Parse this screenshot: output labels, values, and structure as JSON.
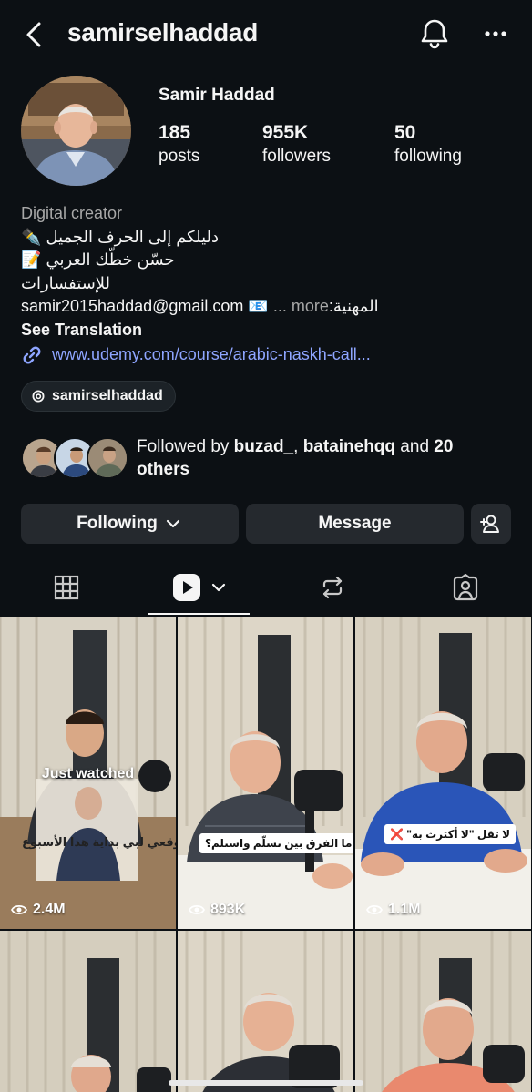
{
  "header": {
    "username": "samirselhaddad",
    "back_icon": "chevron-left-icon",
    "notifications_icon": "bell-icon",
    "more_icon": "ellipsis-icon"
  },
  "profile": {
    "name": "Samir Haddad",
    "stats": [
      {
        "value": "185",
        "label": "posts"
      },
      {
        "value": "955K",
        "label": "followers"
      },
      {
        "value": "50",
        "label": "following"
      }
    ],
    "category": "Digital creator",
    "bio_lines": [
      "دليلكم إلى الحرف الجميل",
      "حسّن خطّك العربي",
      "للإستفسارات",
      "المهنية:"
    ],
    "email": "samir2015haddad@gmail.com",
    "more_label": "... more",
    "see_translation": "See Translation",
    "link": "www.udemy.com/course/arabic-naskh-call...",
    "threads_handle": "samirselhaddad"
  },
  "followed_by": {
    "prefix": "Followed by ",
    "user1": "buzad_",
    "sep": ", ",
    "user2": "batainehqq",
    "and": " and ",
    "others": "20 others"
  },
  "actions": {
    "following_label": "Following",
    "message_label": "Message",
    "add_person_icon": "add-person-icon"
  },
  "tabs": [
    {
      "icon": "grid-icon"
    },
    {
      "icon": "reels-icon",
      "active": true
    },
    {
      "icon": "repost-icon"
    },
    {
      "icon": "tagged-icon"
    }
  ],
  "grid": [
    {
      "views": "2.4M",
      "badge": "Just watched",
      "caption": "توقعي لبي بداية هذا الأسبوع"
    },
    {
      "views": "893K",
      "caption": "ما الفرق بين تسلّم واستلم؟"
    },
    {
      "views": "1.1M",
      "caption": "لا تقل \"لا أكترث به\" ❌"
    },
    {
      "views": ""
    },
    {
      "views": ""
    },
    {
      "views": ""
    }
  ],
  "colors": {
    "background": "#0c1014",
    "button": "#25292e",
    "link": "#8ea5ff",
    "secondary_text": "#a8a8a8"
  }
}
